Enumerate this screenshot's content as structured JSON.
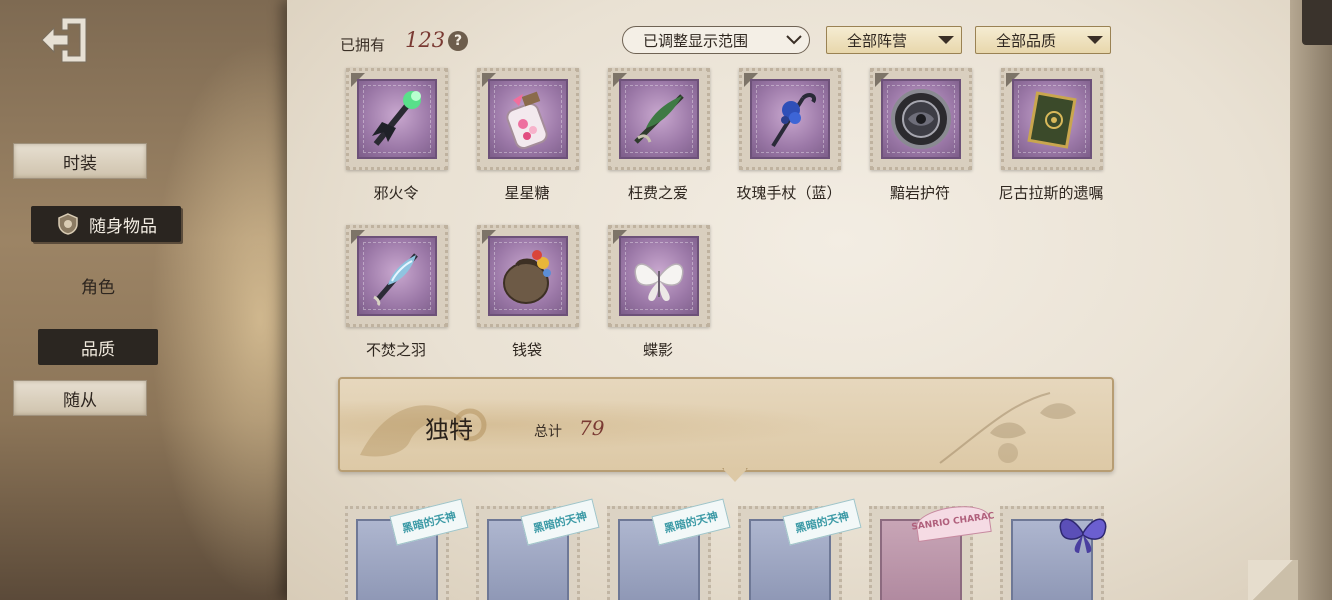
{
  "nav": {
    "items": [
      {
        "label": "时装"
      },
      {
        "label": "随身物品"
      },
      {
        "label": "角色"
      },
      {
        "label": "品质"
      },
      {
        "label": "随从"
      }
    ]
  },
  "header": {
    "owned_label": "已拥有",
    "owned_count": "123",
    "help_symbol": "?"
  },
  "filters": {
    "range": "已调整显示范围",
    "faction": "全部阵营",
    "quality": "全部品质"
  },
  "items": [
    {
      "name": "邪火令",
      "icon": "dark-scepter-green-flame-icon"
    },
    {
      "name": "星星糖",
      "icon": "candy-jar-icon"
    },
    {
      "name": "枉费之爱",
      "icon": "leaf-sword-icon"
    },
    {
      "name": "玫瑰手杖（蓝）",
      "icon": "blue-rose-cane-icon"
    },
    {
      "name": "黯岩护符",
      "icon": "dark-stone-amulet-icon"
    },
    {
      "name": "尼古拉斯的遗嘱",
      "icon": "green-book-icon"
    },
    {
      "name": "不焚之羽",
      "icon": "blue-feather-blade-icon"
    },
    {
      "name": "钱袋",
      "icon": "money-bag-icon"
    },
    {
      "name": "蝶影",
      "icon": "white-butterfly-icon"
    }
  ],
  "unique_section": {
    "title": "独特",
    "total_label": "总计",
    "total_value": "79"
  },
  "bottom_row": {
    "tag_text": "黑暗的天神",
    "pink_tag_text": "SANRIO CHARAC"
  },
  "colors": {
    "count_red": "#7a3a33",
    "stamp_purple": "#9b78a7",
    "nav_active": "#2a2520"
  }
}
